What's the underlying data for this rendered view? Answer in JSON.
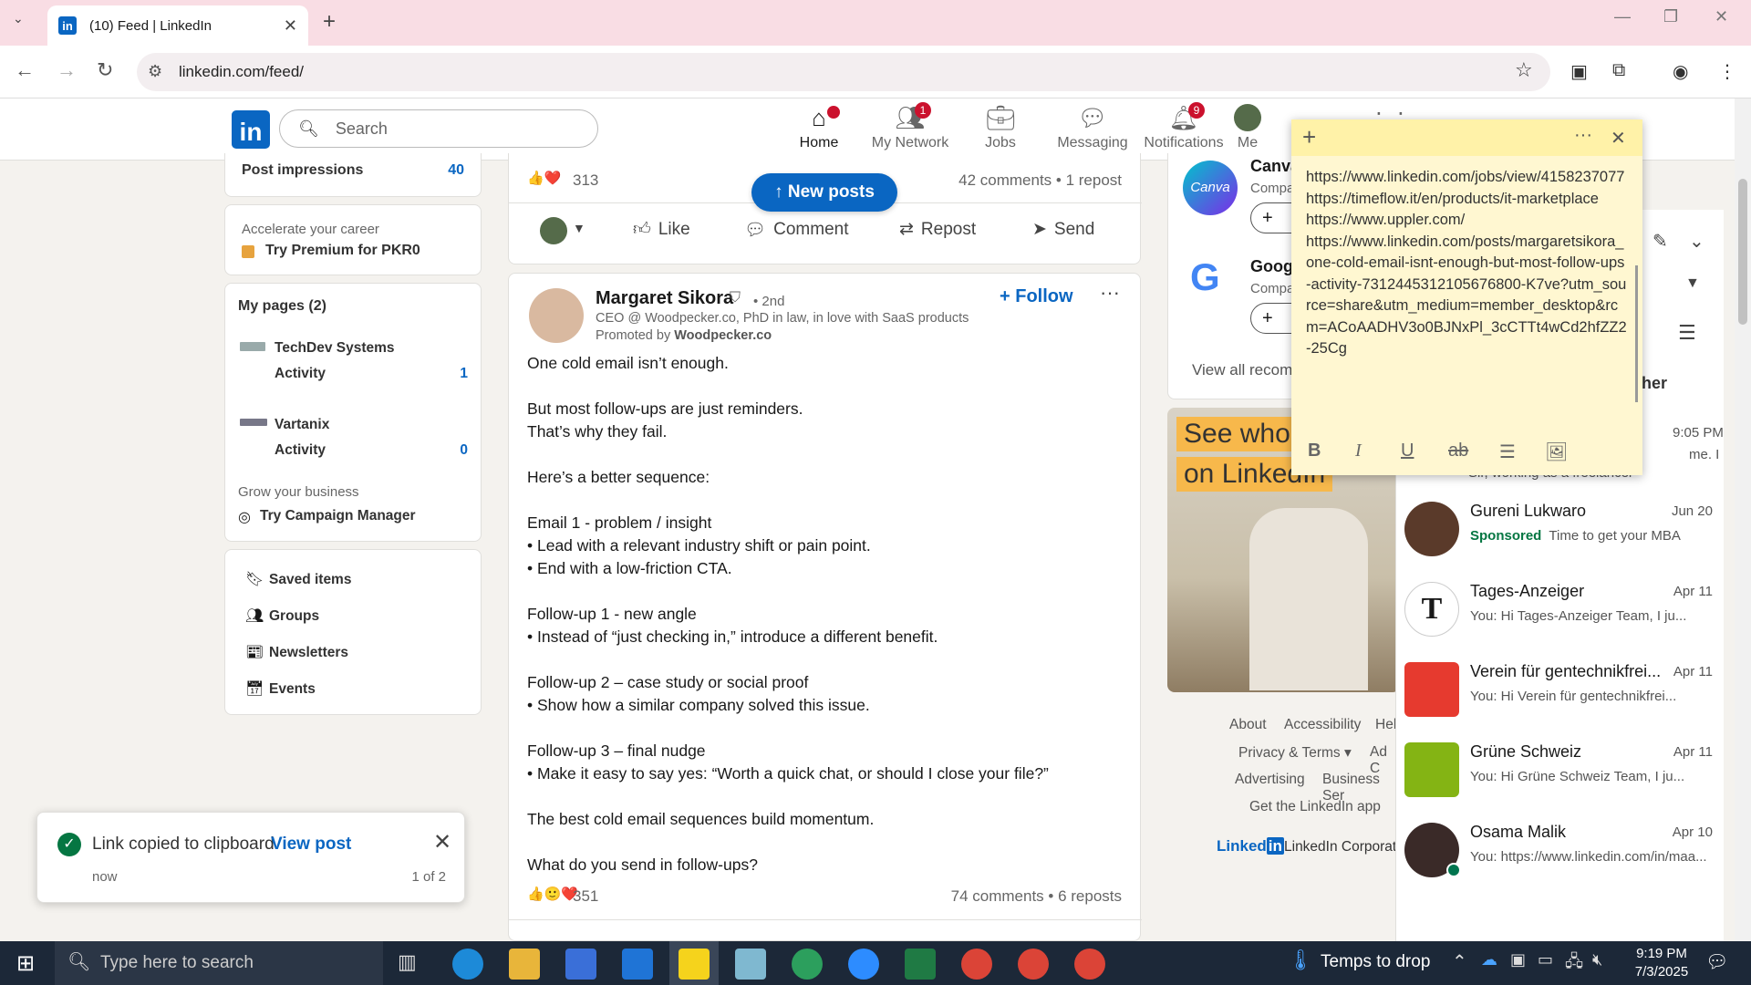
{
  "browser": {
    "tab_title": "(10) Feed | LinkedIn",
    "url": "linkedin.com/feed/"
  },
  "linkedin_nav": {
    "search_placeholder": "Search",
    "items": [
      {
        "label": "Home",
        "badge": ""
      },
      {
        "label": "My Network",
        "badge": "1"
      },
      {
        "label": "Jobs",
        "badge": ""
      },
      {
        "label": "Messaging",
        "badge": ""
      },
      {
        "label": "Notifications",
        "badge": "9"
      },
      {
        "label": "Me",
        "badge": ""
      }
    ]
  },
  "left_sidebar": {
    "post_impressions_label": "Post impressions",
    "post_impressions_value": "40",
    "premium_prompt": "Accelerate your career",
    "premium_cta": "Try Premium for PKR0",
    "my_pages_title": "My pages (2)",
    "pages": [
      {
        "name": "TechDev Systems",
        "activity_label": "Activity",
        "activity_count": "1"
      },
      {
        "name": "Vartanix",
        "activity_label": "Activity",
        "activity_count": "0"
      }
    ],
    "grow_label": "Grow your business",
    "campaign_cta": "Try Campaign Manager",
    "links": [
      "Saved items",
      "Groups",
      "Newsletters",
      "Events"
    ]
  },
  "toast": {
    "message": "Link copied to clipboard.",
    "link": "View post",
    "time": "now",
    "counter": "1 of 2"
  },
  "top_post": {
    "reactions": "313",
    "comments_reposts": "42 comments • 1 repost",
    "new_posts_label": "↑ New posts",
    "actions": [
      "Like",
      "Comment",
      "Repost",
      "Send"
    ]
  },
  "post": {
    "author": "Margaret Sikora",
    "degree": "• 2nd",
    "headline": "CEO @ Woodpecker.co, PhD in law, in love with SaaS products",
    "promoted_prefix": "Promoted by",
    "promoted_by": "Woodpecker.co",
    "follow_label": "+ Follow",
    "body": "One cold email isn’t enough.\n\nBut most follow-ups are just reminders.\nThat’s why they fail.\n\nHere’s a better sequence:\n\nEmail 1 - problem / insight\n• Lead with a relevant industry shift or pain point.\n• End with a low-friction CTA.\n\nFollow-up 1 - new angle\n• Instead of “just checking in,” introduce a different benefit.\n\nFollow-up 2 – case study or social proof\n• Show how a similar company solved this issue.\n\nFollow-up 3 – final nudge\n• Make it easy to say yes: “Worth a quick chat, or should I close your file?”\n\nThe best cold email sequences build momentum.\n\nWhat do you send in follow-ups?",
    "reactions": "351",
    "comments_reposts": "74 comments • 6 reposts"
  },
  "right_rail": {
    "companies": [
      {
        "name": "Canva",
        "sub": "Compa"
      },
      {
        "name": "Googl",
        "sub": "Compa"
      }
    ],
    "view_all": "View all recom",
    "ad_line1": "See who",
    "ad_line2": "on LinkedIn",
    "footer_links": [
      "About",
      "Accessibility",
      "Hel",
      "Privacy & Terms ▾",
      "Ad C",
      "Advertising",
      "Business Ser",
      "Get the LinkedIn app"
    ],
    "footer_brand": "Linked",
    "footer_corp": "LinkedIn Corporati"
  },
  "sticky_note": {
    "text": "https://www.linkedin.com/jobs/view/4158237077\nhttps://timeflow.it/en/products/it-marketplace\nhttps://www.uppler.com/\nhttps://www.linkedin.com/posts/margaretsikora_one-cold-email-isnt-enough-but-most-follow-ups-activity-7312445312105676800-K7ve?utm_source=share&utm_medium=member_desktop&rcm=ACoAADHV3o0BJNxPl_3cCTTt4wCd2hfZZ2-25Cg",
    "format_buttons": [
      "B",
      "I",
      "U",
      "ab",
      "☰",
      "🖼"
    ]
  },
  "messaging": {
    "partial_header": "her",
    "first_time": "9:05 PM",
    "first_preview": "me. I",
    "first_preview2": "Sir, working as a freelancer",
    "items": [
      {
        "name": "Gureni Lukwaro",
        "date": "Jun 20",
        "sponsored": "Sponsored",
        "preview": "Time to get your MBA"
      },
      {
        "name": "Tages-Anzeiger",
        "date": "Apr 11",
        "sponsored": "",
        "preview": "You: Hi Tages-Anzeiger Team, I ju..."
      },
      {
        "name": "Verein für gentechnikfrei...",
        "date": "Apr 11",
        "sponsored": "",
        "preview": "You: Hi Verein für gentechnikfrei..."
      },
      {
        "name": "Grüne Schweiz",
        "date": "Apr 11",
        "sponsored": "",
        "preview": "You: Hi Grüne Schweiz Team, I ju..."
      },
      {
        "name": "Osama Malik",
        "date": "Apr 10",
        "sponsored": "",
        "preview": "You: https://www.linkedin.com/in/maa..."
      }
    ]
  },
  "taskbar": {
    "search_placeholder": "Type here to search",
    "weather": "Temps to drop",
    "time": "9:19 PM",
    "date": "7/3/2025"
  },
  "colors": {
    "linkedin_blue": "#0a66c2",
    "note_yellow": "#fff7d1",
    "notification_red": "#cb112d"
  }
}
